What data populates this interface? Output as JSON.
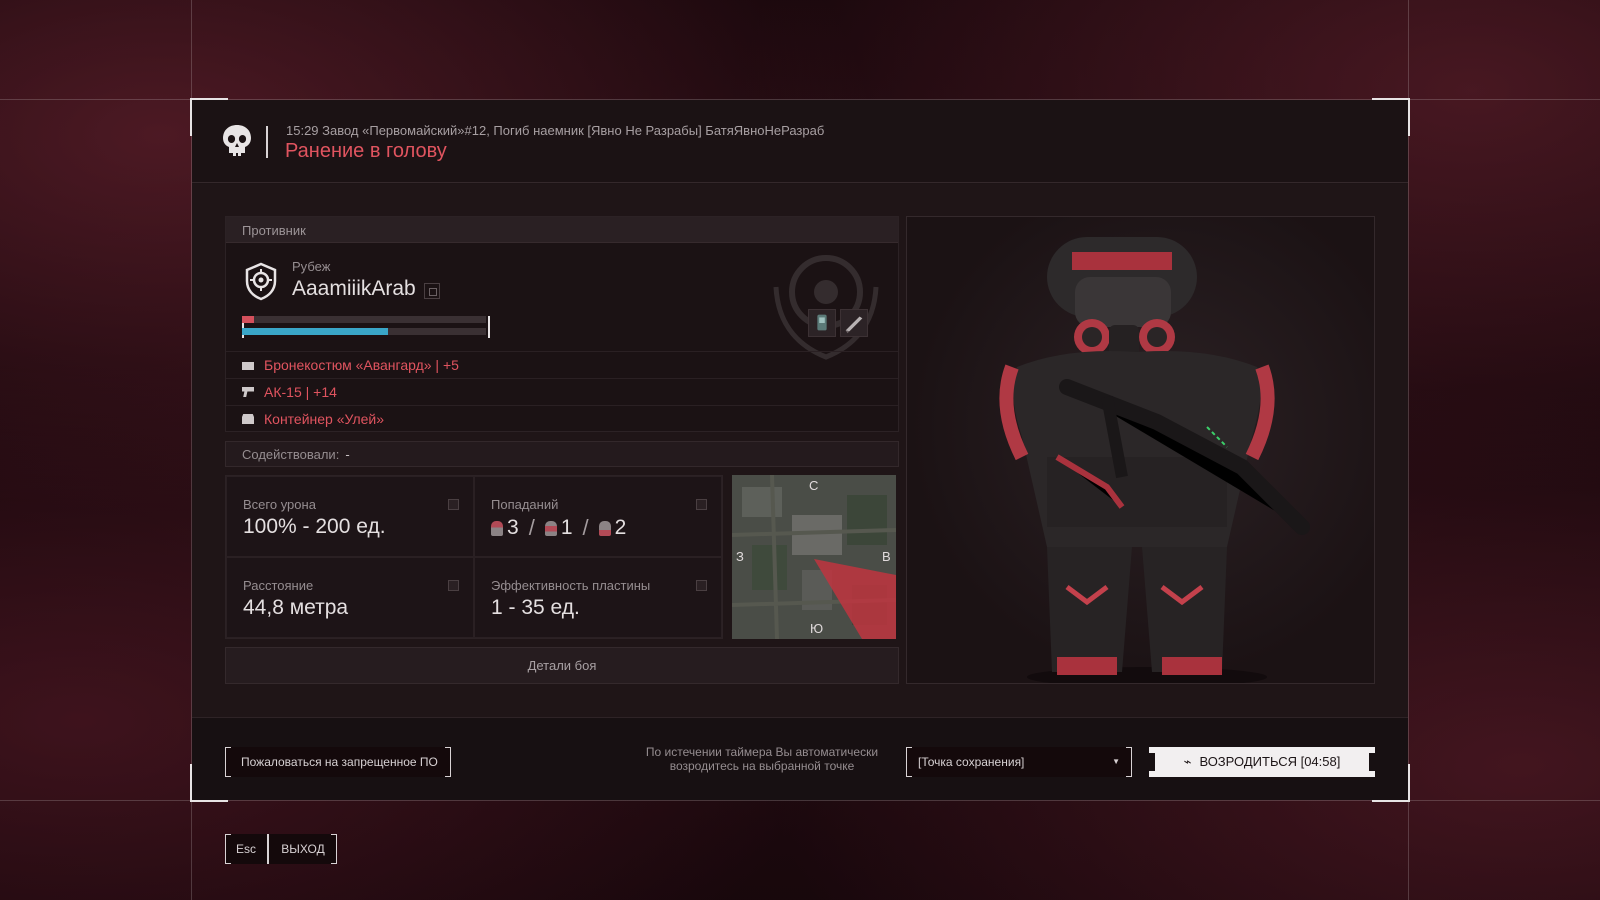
{
  "header": {
    "event_line": "15:29 Завод «Первомайский»#12, Погиб наемник [Явно Не Разрабы] БатяЯвноНеРазраб",
    "death_reason": "Ранение в голову"
  },
  "enemy": {
    "section_label": "Противник",
    "faction": "Рубеж",
    "name": "AaamiiikArab",
    "armor_fraction": 0.05,
    "health_fraction": 0.6,
    "loadout": [
      {
        "icon": "armor-icon",
        "text": "Бронекостюм «Авангард» | +5"
      },
      {
        "icon": "rifle-icon",
        "text": "АК-15 | +14"
      },
      {
        "icon": "container-icon",
        "text": "Контейнер «Улей»"
      }
    ]
  },
  "assist": {
    "label": "Содействовали:",
    "value": "-"
  },
  "stats": {
    "total_damage": {
      "label": "Всего урона",
      "value": "100% - 200 ед."
    },
    "hits": {
      "label": "Попаданий",
      "head": "3",
      "body": "1",
      "legs": "2"
    },
    "distance": {
      "label": "Расстояние",
      "value": "44,8 метра"
    },
    "plate": {
      "label": "Эффективность пластины",
      "value": "1 - 35 ед."
    }
  },
  "minimap": {
    "north": "С",
    "south": "Ю",
    "west": "З",
    "east": "В"
  },
  "details_button": "Детали боя",
  "footer": {
    "report_button": "Пожаловаться на запрещенное ПО",
    "timer_note": "По истечении таймера Вы автоматически возродитесь на выбранной точке",
    "spawn_select": "[Точка сохранения]",
    "respawn_button": "ВОЗРОДИТЬСЯ [04:58]"
  },
  "exit": {
    "key": "Esc",
    "label": "ВЫХОД"
  },
  "colors": {
    "accent_red": "#e0545f",
    "hp_blue": "#3aa6c8"
  }
}
